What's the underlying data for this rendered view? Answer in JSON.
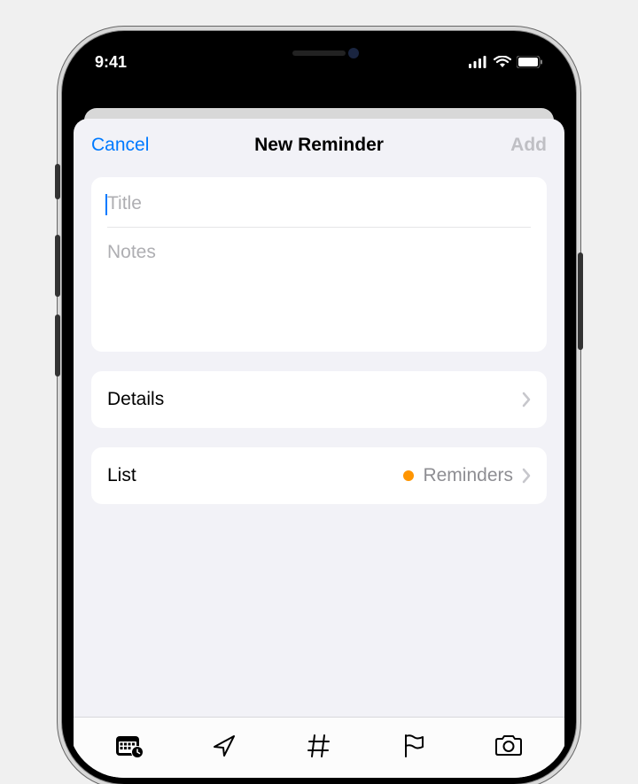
{
  "status_bar": {
    "time": "9:41"
  },
  "sheet": {
    "cancel_label": "Cancel",
    "title": "New Reminder",
    "add_label": "Add"
  },
  "fields": {
    "title_placeholder": "Title",
    "notes_placeholder": "Notes"
  },
  "rows": {
    "details_label": "Details",
    "list_label": "List",
    "list_value": "Reminders",
    "list_color": "#ff9500"
  },
  "colors": {
    "accent": "#007aff",
    "disabled": "#bfbfc4",
    "placeholder": "#aeaeb2"
  }
}
